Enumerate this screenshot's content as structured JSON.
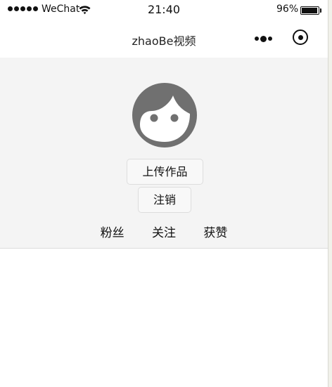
{
  "status_bar": {
    "carrier": "WeChat",
    "time": "21:40",
    "battery_percent": "96%",
    "battery_level": 0.96,
    "signal_icon": "signal-dots-icon",
    "wifi_icon": "wifi-icon",
    "battery_icon": "battery-icon"
  },
  "nav": {
    "title": "zhaoBe视频",
    "more_icon": "more-dots-icon",
    "close_icon": "capsule-close-icon"
  },
  "profile": {
    "avatar_icon": "face-avatar-icon",
    "upload_label": "上传作品",
    "logout_label": "注销",
    "stats": [
      {
        "label": "粉丝"
      },
      {
        "label": "关注"
      },
      {
        "label": "获赞"
      }
    ]
  },
  "colors": {
    "avatar": "#707070",
    "profile_bg": "#f4f4f4",
    "nav_bg": "#ffffff"
  }
}
